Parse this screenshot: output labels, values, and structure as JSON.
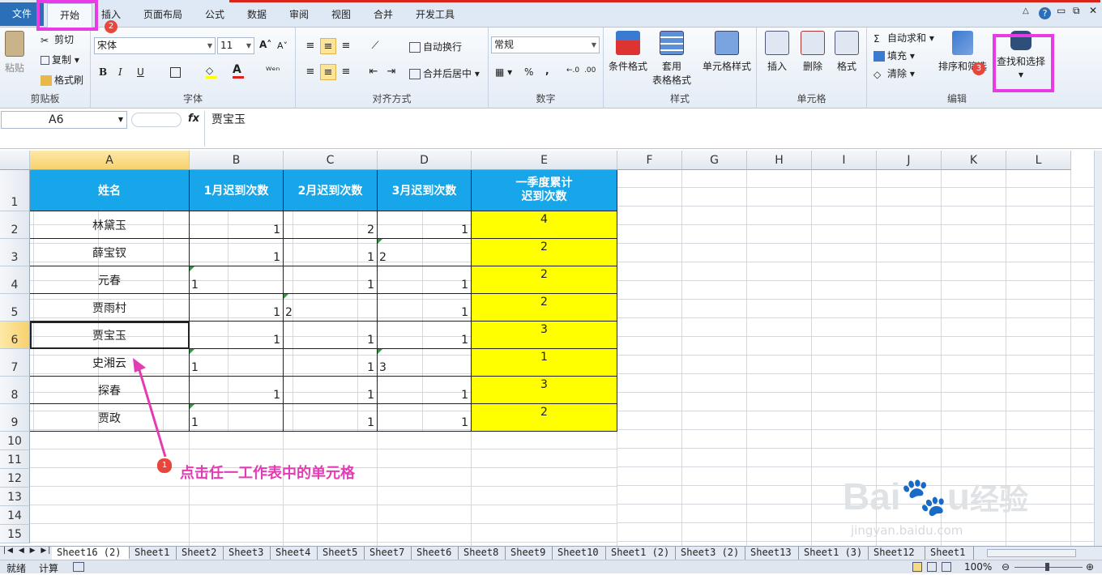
{
  "tabs": {
    "file": "文件",
    "home": "开始",
    "insert": "插入",
    "layout": "页面布局",
    "formulas": "公式",
    "data": "数据",
    "review": "审阅",
    "view": "视图",
    "merge": "合并",
    "developer": "开发工具"
  },
  "ribbon": {
    "clipboard": {
      "paste": "粘贴",
      "cut": "剪切",
      "copy": "复制 ▾",
      "format_painter": "格式刷",
      "label": "剪贴板"
    },
    "font": {
      "name": "宋体",
      "size": "11",
      "label": "字体",
      "bold": "B",
      "italic": "I",
      "underline": "U"
    },
    "align": {
      "wrap": "自动换行",
      "merge": "合并后居中",
      "label": "对齐方式"
    },
    "number": {
      "format": "常规",
      "percent": "%",
      "comma": ",",
      "label": "数字"
    },
    "styles": {
      "cond": "条件格式",
      "table1": "套用",
      "table2": "表格格式",
      "cell": "单元格样式",
      "label": "样式"
    },
    "cells": {
      "insert": "插入",
      "delete": "删除",
      "format": "格式",
      "label": "单元格"
    },
    "edit": {
      "autosum": "自动求和 ▾",
      "fill": "填充 ▾",
      "clear": "清除 ▾",
      "sort": "排序和筛选",
      "find": "查找和选择",
      "label": "编辑"
    }
  },
  "formula_bar": {
    "name": "A6",
    "fx": "fx",
    "value": "贾宝玉"
  },
  "columns": [
    "A",
    "B",
    "C",
    "D",
    "E",
    "F",
    "G",
    "H",
    "I",
    "J",
    "K",
    "L"
  ],
  "rows": [
    "1",
    "2",
    "3",
    "4",
    "5",
    "6",
    "7",
    "8",
    "9",
    "10",
    "11",
    "12",
    "13",
    "14",
    "15"
  ],
  "table": {
    "headers": [
      "姓名",
      "1月迟到次数",
      "2月迟到次数",
      "3月迟到次数"
    ],
    "header_e": [
      "一季度累计",
      "迟到次数"
    ],
    "names": [
      "林黛玉",
      "薛宝钗",
      "元春",
      "贾雨村",
      "贾宝玉",
      "史湘云",
      "探春",
      "贾政"
    ],
    "b": [
      "1",
      "1",
      "1",
      "1",
      "1",
      "1",
      "1",
      "1"
    ],
    "c": [
      "2",
      "1",
      "1",
      "2",
      "1",
      "1",
      "1",
      "1"
    ],
    "d": [
      "1",
      "2",
      "1",
      "1",
      "1",
      "3",
      "1",
      "1"
    ],
    "e": [
      "4",
      "2",
      "2",
      "2",
      "3",
      "1",
      "3",
      "2"
    ]
  },
  "annotations": {
    "b1": "1",
    "b2": "2",
    "b3": "3",
    "text": "点击任一工作表中的单元格"
  },
  "sheets": [
    "Sheet16 (2)",
    "Sheet1",
    "Sheet2",
    "Sheet3",
    "Sheet4",
    "Sheet5",
    "Sheet7",
    "Sheet6",
    "Sheet8",
    "Sheet9",
    "Sheet10",
    "Sheet1 (2)",
    "Sheet3 (2)",
    "Sheet13",
    "Sheet1 (3)",
    "Sheet12",
    "Sheet1"
  ],
  "status": {
    "ready": "就绪",
    "calc": "计算",
    "zoom": "100%"
  },
  "colors": {
    "header": "#16a6e9",
    "yellow": "#ffff00",
    "highlight": "#e83be5",
    "accent": "#2a6fb8"
  }
}
